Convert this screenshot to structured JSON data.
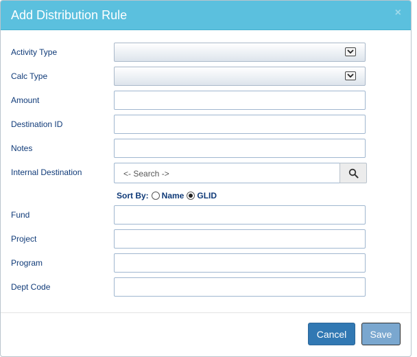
{
  "dialog": {
    "title": "Add Distribution Rule",
    "close_glyph": "×",
    "header_color": "#5bc0de"
  },
  "form": {
    "activity_type": {
      "label": "Activity Type",
      "value": ""
    },
    "calc_type": {
      "label": "Calc Type",
      "value": ""
    },
    "amount": {
      "label": "Amount",
      "value": ""
    },
    "destination_id": {
      "label": "Destination ID",
      "value": ""
    },
    "notes": {
      "label": "Notes",
      "value": ""
    },
    "internal_destination": {
      "label": "Internal Destination",
      "placeholder": "<- Search ->",
      "icon": "search-icon"
    },
    "sort_by": {
      "label": "Sort By:",
      "options": [
        "Name",
        "GLID"
      ],
      "selected": "GLID"
    },
    "fund": {
      "label": "Fund",
      "value": ""
    },
    "project": {
      "label": "Project",
      "value": ""
    },
    "program": {
      "label": "Program",
      "value": ""
    },
    "dept_code": {
      "label": "Dept Code",
      "value": ""
    }
  },
  "footer": {
    "cancel_label": "Cancel",
    "save_label": "Save",
    "primary_color": "#3178b3"
  }
}
